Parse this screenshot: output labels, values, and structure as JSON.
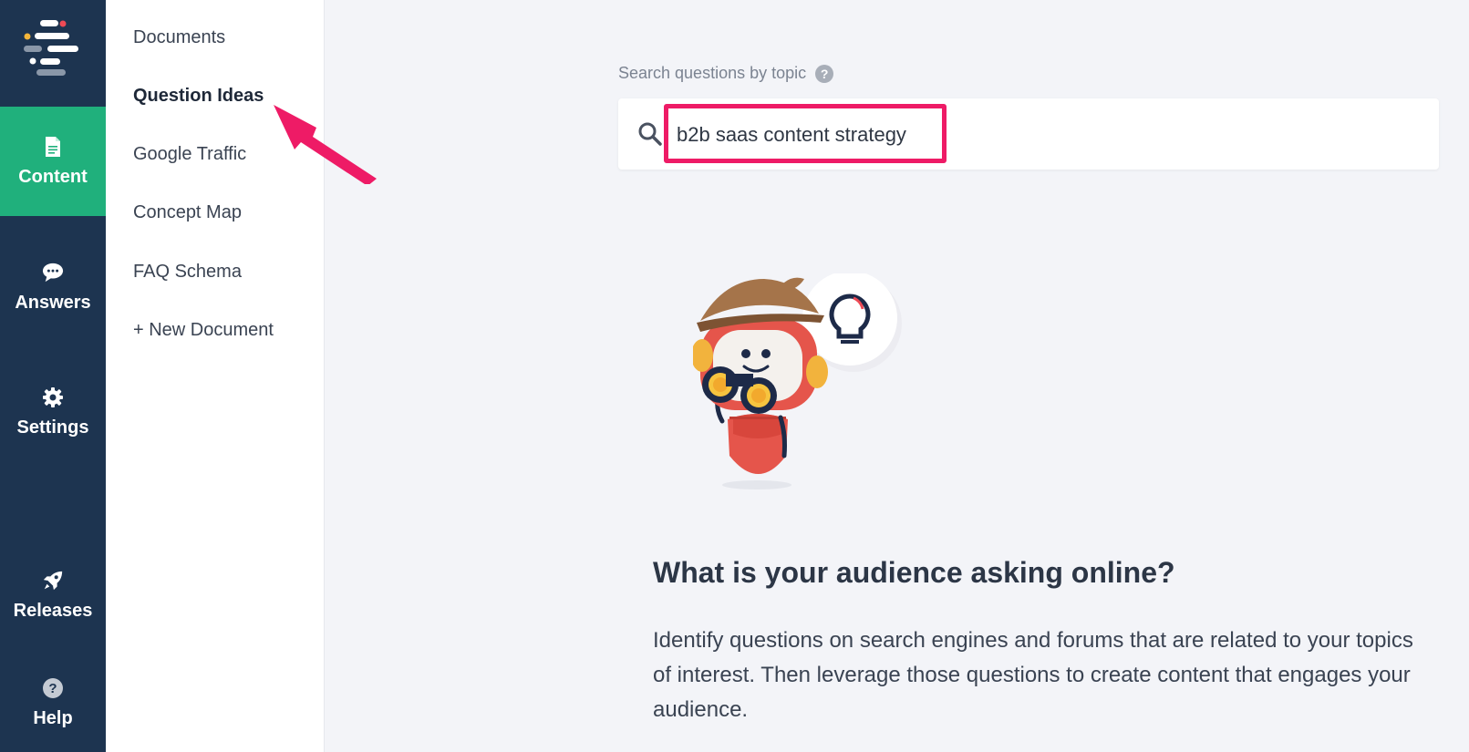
{
  "rail": {
    "items": [
      {
        "label": "Content",
        "icon": "document-icon",
        "active": true
      },
      {
        "label": "Answers",
        "icon": "chat-bubble-icon",
        "active": false
      },
      {
        "label": "Settings",
        "icon": "gear-icon",
        "active": false
      },
      {
        "label": "Releases",
        "icon": "rocket-icon",
        "active": false
      },
      {
        "label": "Help",
        "icon": "question-circle-icon",
        "active": false
      }
    ]
  },
  "subnav": {
    "items": [
      {
        "label": "Documents"
      },
      {
        "label": "Question Ideas"
      },
      {
        "label": "Google Traffic"
      },
      {
        "label": "Concept Map"
      },
      {
        "label": "FAQ Schema"
      },
      {
        "label": "+ New Document"
      }
    ]
  },
  "search": {
    "label": "Search questions by topic",
    "help_glyph": "?",
    "value": "b2b saas content strategy"
  },
  "main": {
    "headline": "What is your audience asking online?",
    "description": "Identify questions on search engines and forums that are related to your topics of interest. Then leverage those questions to create content that engages your audience."
  },
  "colors": {
    "rail_bg": "#1d3450",
    "active_green": "#20b07c",
    "highlight_pink": "#ee1b66"
  }
}
